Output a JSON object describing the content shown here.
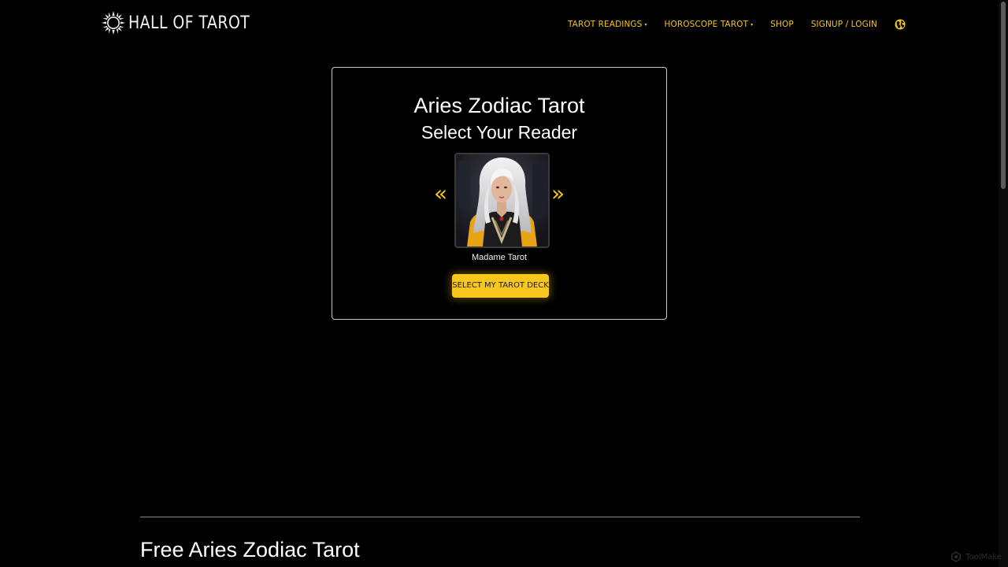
{
  "header": {
    "logo_text": "HALL OF TAROT",
    "nav": [
      {
        "label": "TAROT READINGS",
        "has_dropdown": true
      },
      {
        "label": "HOROSCOPE TAROT",
        "has_dropdown": true
      },
      {
        "label": "SHOP",
        "has_dropdown": false
      },
      {
        "label": "SIGNUP / LOGIN",
        "has_dropdown": false
      }
    ],
    "dropdown_caret": "▾",
    "globe_icon": "globe-icon"
  },
  "reader_card": {
    "title": "Aries Zodiac Tarot",
    "subtitle": "Select Your Reader",
    "prev_arrow": "«",
    "next_arrow": "»",
    "reader_name": "Madame Tarot",
    "select_button": "SELECT MY TAROT DECK"
  },
  "section": {
    "heading": "Free Aries Zodiac Tarot"
  },
  "watermark": {
    "text": "ToolMake"
  },
  "colors": {
    "background": "#000000",
    "accent": "#f5c518",
    "button": "#f8c61c",
    "text": "#ffffff",
    "card_border": "#c8c8c8"
  }
}
